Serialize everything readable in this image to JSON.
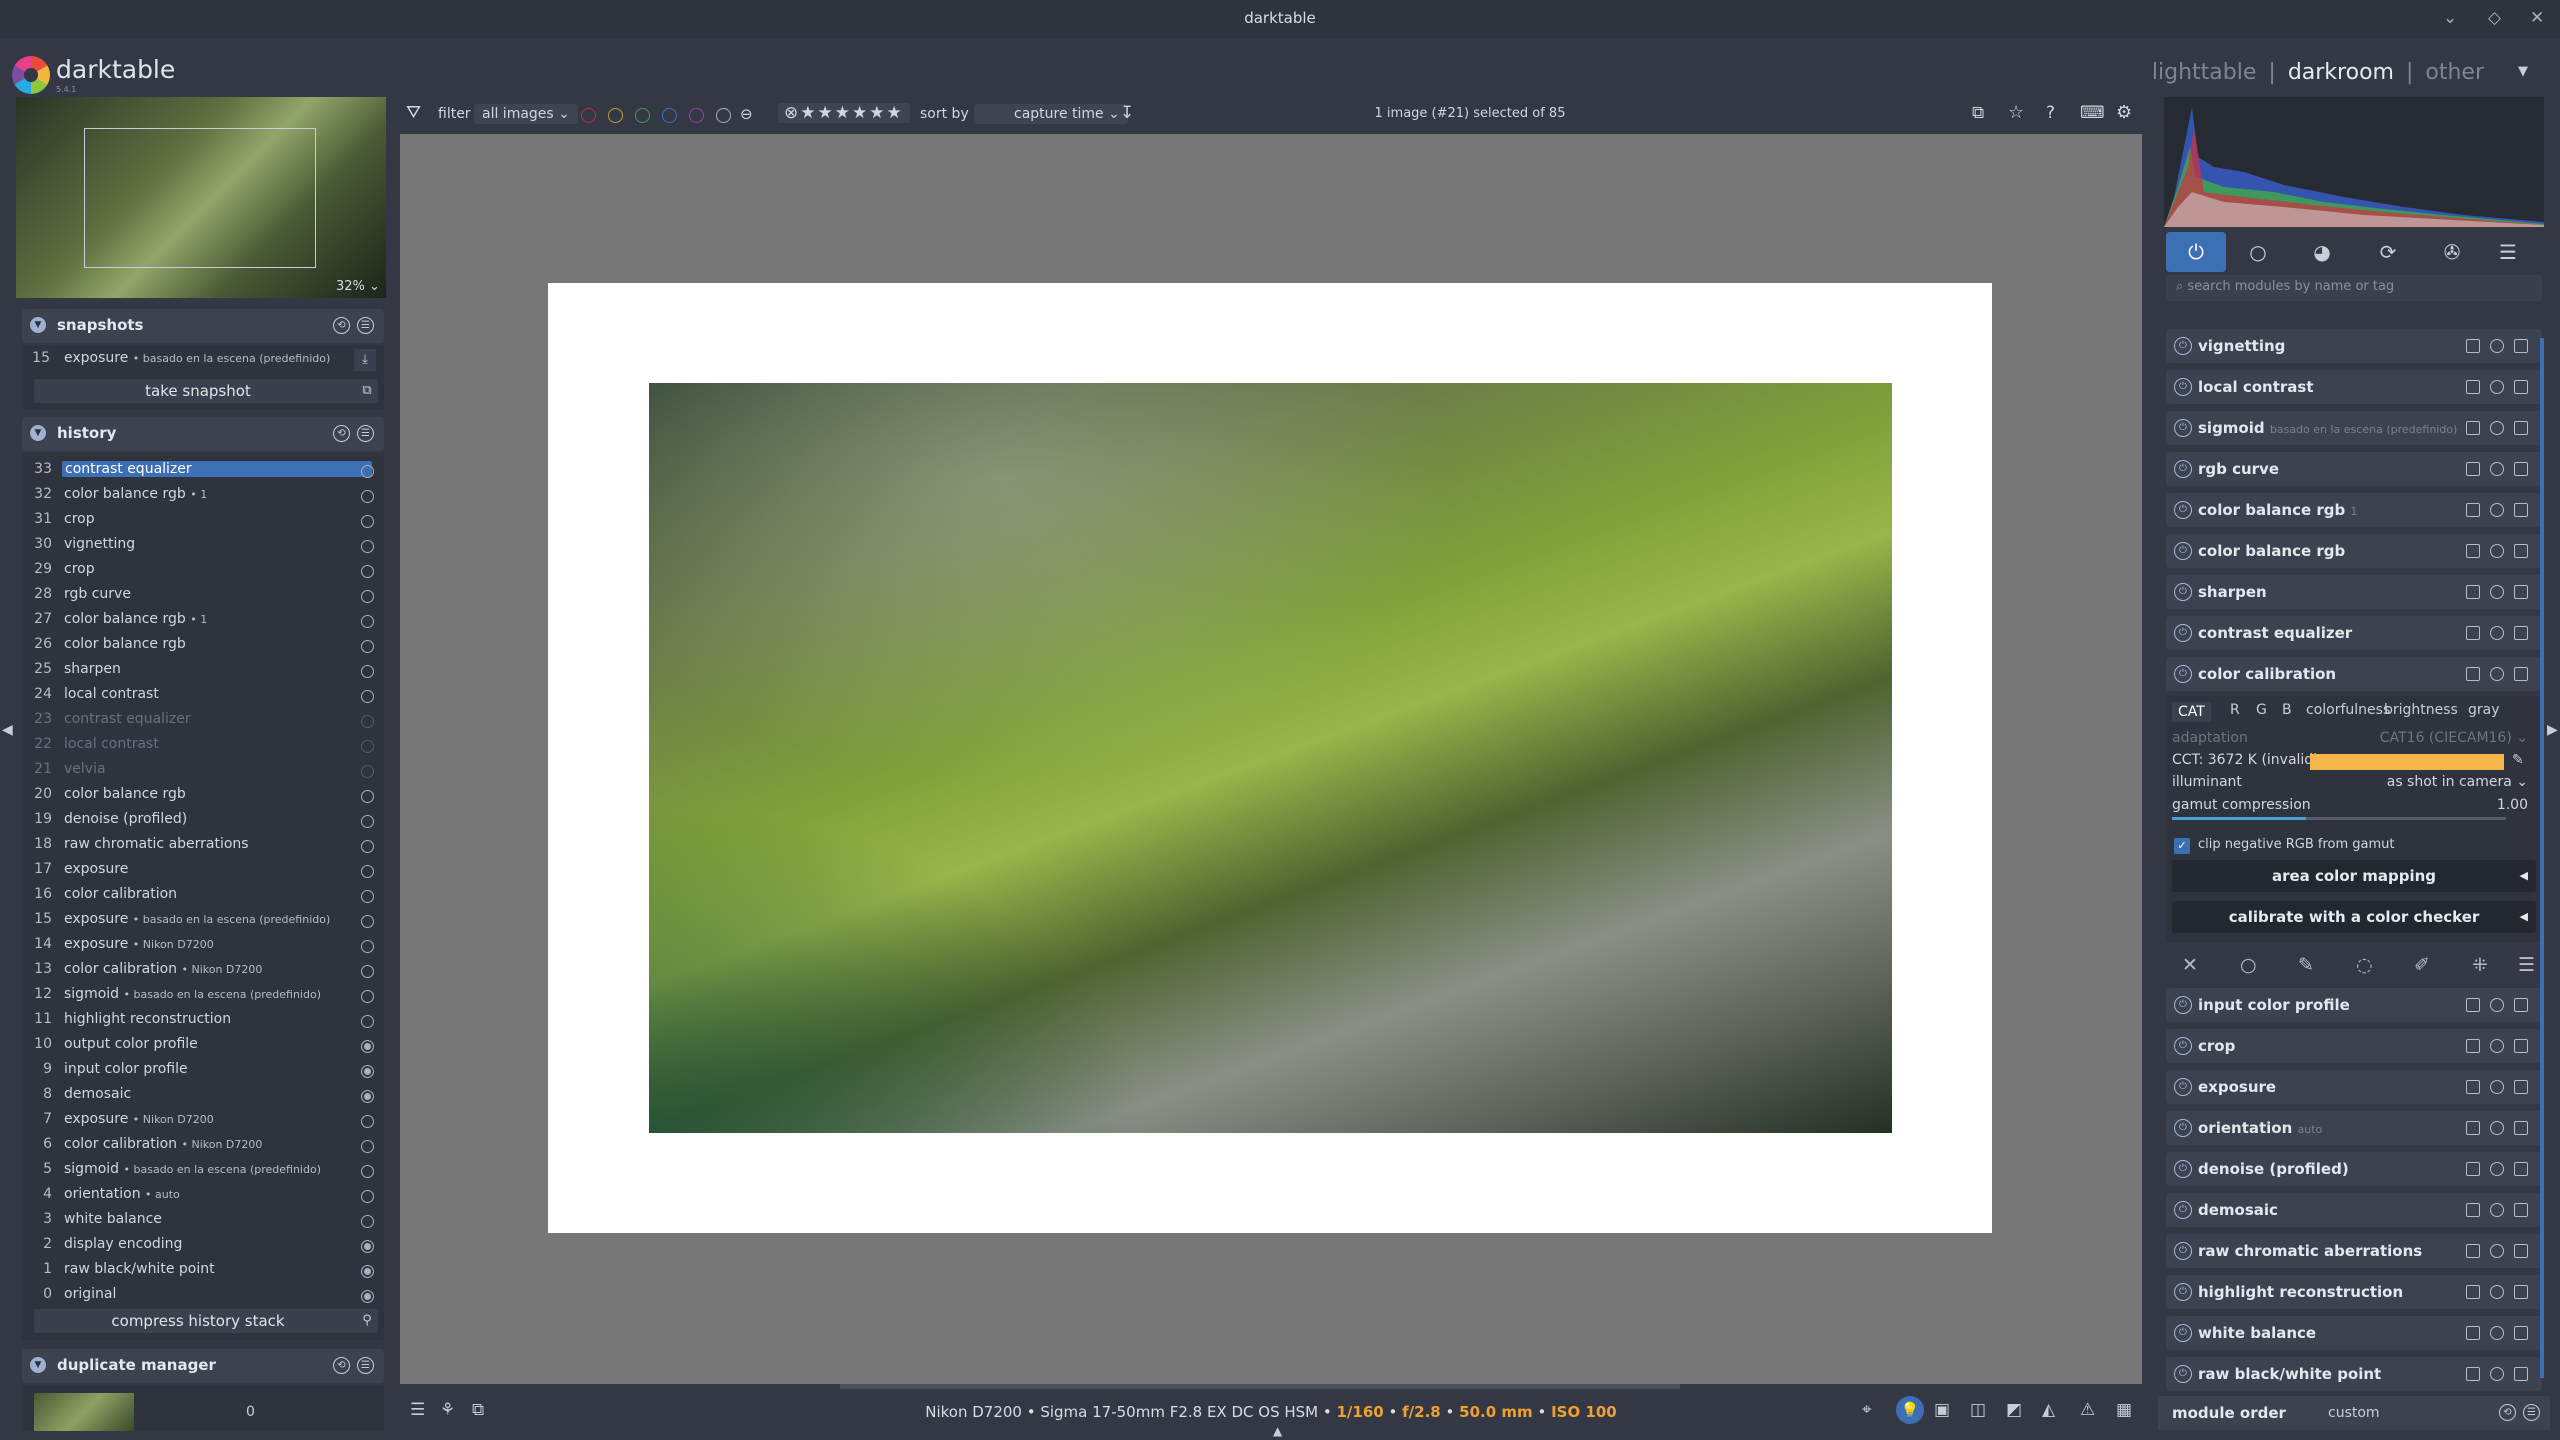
{
  "window": {
    "title": "darktable"
  },
  "app": {
    "name": "darktable",
    "version": "5.4.1"
  },
  "views": {
    "lighttable": "lighttable",
    "darkroom": "darkroom",
    "other": "other",
    "sep": "|"
  },
  "navigation": {
    "zoom": "32%"
  },
  "snapshots": {
    "title": "snapshots",
    "item_num": "15",
    "item_label": "exposure",
    "item_detail": "• basado en la escena (predefinido)",
    "button": "take snapshot"
  },
  "history": {
    "title": "history",
    "items": [
      {
        "num": "33",
        "label": "contrast equalizer",
        "detail": ""
      },
      {
        "num": "32",
        "label": "color balance rgb",
        "detail": "• 1"
      },
      {
        "num": "31",
        "label": "crop",
        "detail": ""
      },
      {
        "num": "30",
        "label": "vignetting",
        "detail": ""
      },
      {
        "num": "29",
        "label": "crop",
        "detail": ""
      },
      {
        "num": "28",
        "label": "rgb curve",
        "detail": ""
      },
      {
        "num": "27",
        "label": "color balance rgb",
        "detail": "• 1"
      },
      {
        "num": "26",
        "label": "color balance rgb",
        "detail": ""
      },
      {
        "num": "25",
        "label": "sharpen",
        "detail": ""
      },
      {
        "num": "24",
        "label": "local contrast",
        "detail": ""
      },
      {
        "num": "23",
        "label": "contrast equalizer",
        "detail": ""
      },
      {
        "num": "22",
        "label": "local contrast",
        "detail": ""
      },
      {
        "num": "21",
        "label": "velvia",
        "detail": ""
      },
      {
        "num": "20",
        "label": "color balance rgb",
        "detail": ""
      },
      {
        "num": "19",
        "label": "denoise (profiled)",
        "detail": ""
      },
      {
        "num": "18",
        "label": "raw chromatic aberrations",
        "detail": ""
      },
      {
        "num": "17",
        "label": "exposure",
        "detail": ""
      },
      {
        "num": "16",
        "label": "color calibration",
        "detail": ""
      },
      {
        "num": "15",
        "label": "exposure",
        "detail": "• basado en la escena (predefinido)"
      },
      {
        "num": "14",
        "label": "exposure",
        "detail": "• Nikon D7200"
      },
      {
        "num": "13",
        "label": "color calibration",
        "detail": "• Nikon D7200"
      },
      {
        "num": "12",
        "label": "sigmoid",
        "detail": "• basado en la escena (predefinido)"
      },
      {
        "num": "11",
        "label": "highlight reconstruction",
        "detail": ""
      },
      {
        "num": "10",
        "label": "output color profile",
        "detail": ""
      },
      {
        "num": "9",
        "label": "input color profile",
        "detail": ""
      },
      {
        "num": "8",
        "label": "demosaic",
        "detail": ""
      },
      {
        "num": "7",
        "label": "exposure",
        "detail": "• Nikon D7200"
      },
      {
        "num": "6",
        "label": "color calibration",
        "detail": "• Nikon D7200"
      },
      {
        "num": "5",
        "label": "sigmoid",
        "detail": "• basado en la escena (predefinido)"
      },
      {
        "num": "4",
        "label": "orientation",
        "detail": "• auto"
      },
      {
        "num": "3",
        "label": "white balance",
        "detail": ""
      },
      {
        "num": "2",
        "label": "display encoding",
        "detail": ""
      },
      {
        "num": "1",
        "label": "raw black/white point",
        "detail": ""
      },
      {
        "num": "0",
        "label": "original",
        "detail": ""
      }
    ],
    "button": "compress history stack"
  },
  "duplicate_manager": {
    "title": "duplicate manager",
    "count": "0"
  },
  "filterbar": {
    "filter_label": "filter",
    "filter_value": "all images",
    "sort_label": "sort by",
    "sort_value": "capture time",
    "selection": "1 image (#21) selected of 85"
  },
  "exif": {
    "camera": "Nikon D7200 • Sigma 17-50mm F2.8 EX DC OS HSM •",
    "shutter": "1/160",
    "aperture": "f/2.8",
    "focal": "50.0 mm",
    "iso": "ISO 100",
    "sep": "•"
  },
  "right": {
    "search_placeholder": "search modules by name or tag",
    "modules_top": [
      {
        "label": "vignetting",
        "detail": ""
      },
      {
        "label": "local contrast",
        "detail": ""
      },
      {
        "label": "sigmoid",
        "detail": "basado en la escena (predefinido)"
      },
      {
        "label": "rgb curve",
        "detail": ""
      },
      {
        "label": "color balance rgb",
        "detail": "1"
      },
      {
        "label": "color balance rgb",
        "detail": ""
      },
      {
        "label": "sharpen",
        "detail": ""
      },
      {
        "label": "contrast equalizer",
        "detail": ""
      },
      {
        "label": "color calibration",
        "detail": ""
      }
    ],
    "color_calibration": {
      "tabs": [
        "CAT",
        "R",
        "G",
        "B",
        "colorfulness",
        "brightness",
        "gray"
      ],
      "adaptation_label": "adaptation",
      "adaptation_value": "CAT16 (CIECAM16)",
      "cct_label": "CCT: 3672 K (invalid)",
      "illuminant_label": "illuminant",
      "illuminant_value": "as shot in camera",
      "gamut_label": "gamut compression",
      "gamut_value": "1.00",
      "gamut_level": 0.4,
      "clip_label": "clip negative RGB from gamut",
      "area_button": "area color mapping",
      "checker_button": "calibrate with a color checker",
      "cct_color": "#f5b54a"
    },
    "modules_bottom": [
      {
        "label": "input color profile",
        "detail": ""
      },
      {
        "label": "crop",
        "detail": ""
      },
      {
        "label": "exposure",
        "detail": ""
      },
      {
        "label": "orientation",
        "detail": "auto"
      },
      {
        "label": "denoise (profiled)",
        "detail": ""
      },
      {
        "label": "demosaic",
        "detail": ""
      },
      {
        "label": "raw chromatic aberrations",
        "detail": ""
      },
      {
        "label": "highlight reconstruction",
        "detail": ""
      },
      {
        "label": "white balance",
        "detail": ""
      },
      {
        "label": "raw black/white point",
        "detail": ""
      }
    ],
    "module_order_label": "module order",
    "module_order_value": "custom"
  },
  "colors": {
    "accent": "#3d6fb5",
    "highlight": "#f0a030"
  }
}
